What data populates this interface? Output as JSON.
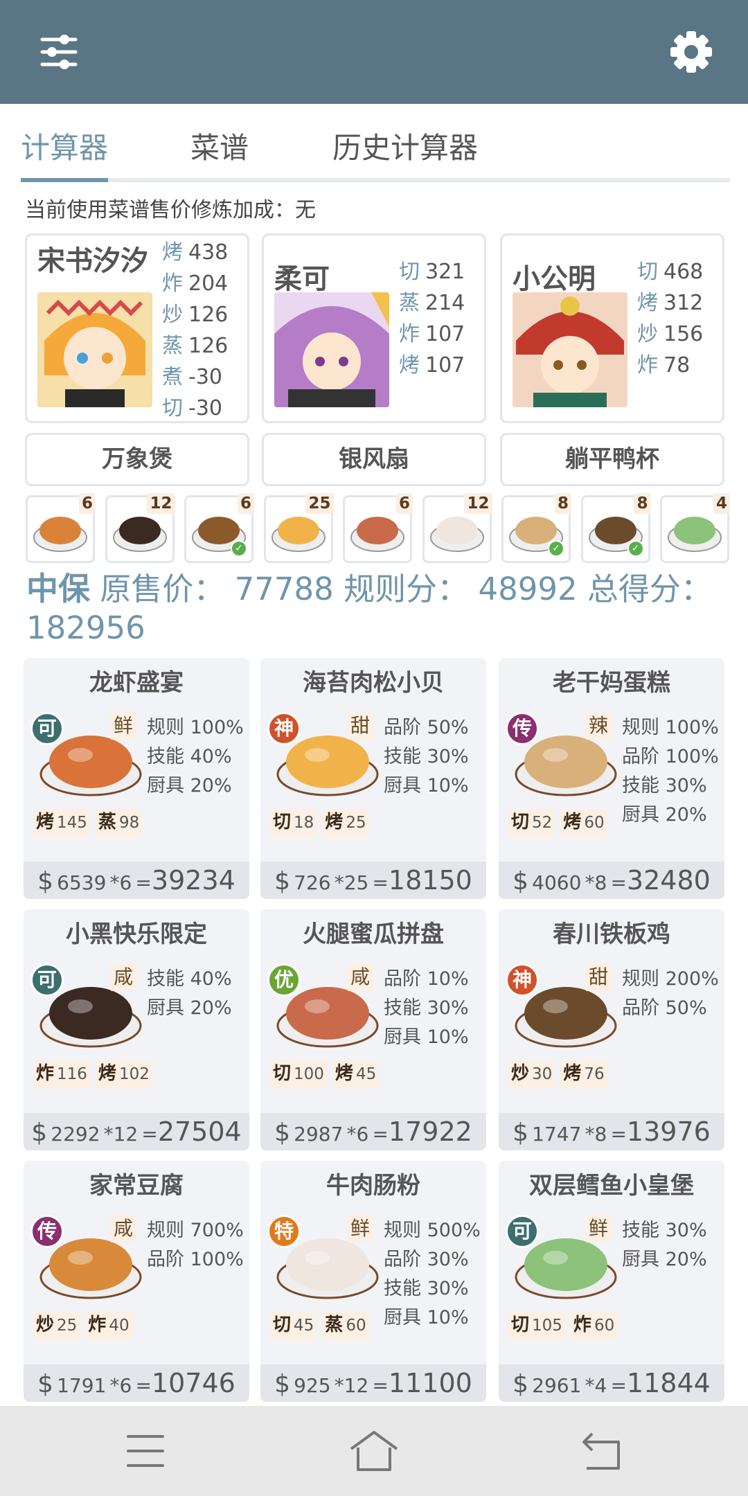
{
  "colors": {
    "header": "#5a7583",
    "accent": "#6f95ab"
  },
  "header": {
    "left_icon": "sliders-icon",
    "right_icon": "gear-icon"
  },
  "tabs": [
    {
      "label": "计算器",
      "active": true
    },
    {
      "label": "菜谱",
      "active": false
    },
    {
      "label": "历史计算器",
      "active": false
    }
  ],
  "bonus_text": "当前使用菜谱售价修炼加成：无",
  "chefs": [
    {
      "name": "宋书汐汐",
      "skills": [
        {
          "k": "烤",
          "v": "438"
        },
        {
          "k": "炸",
          "v": "204"
        },
        {
          "k": "炒",
          "v": "126"
        },
        {
          "k": "蒸",
          "v": "126"
        },
        {
          "k": "煮",
          "v": "-30"
        },
        {
          "k": "切",
          "v": "-30"
        }
      ]
    },
    {
      "name": "柔可",
      "skills": [
        {
          "k": "切",
          "v": "321"
        },
        {
          "k": "蒸",
          "v": "214"
        },
        {
          "k": "炸",
          "v": "107"
        },
        {
          "k": "烤",
          "v": "107"
        }
      ]
    },
    {
      "name": "小公明",
      "skills": [
        {
          "k": "切",
          "v": "468"
        },
        {
          "k": "烤",
          "v": "312"
        },
        {
          "k": "炒",
          "v": "156"
        },
        {
          "k": "炸",
          "v": "78"
        }
      ]
    }
  ],
  "equipment": [
    "万象煲",
    "银风扇",
    "躺平鸭杯"
  ],
  "thumbs": [
    {
      "count": "6",
      "checked": false
    },
    {
      "count": "12",
      "checked": false
    },
    {
      "count": "6",
      "checked": true
    },
    {
      "count": "25",
      "checked": false
    },
    {
      "count": "6",
      "checked": false
    },
    {
      "count": "12",
      "checked": false
    },
    {
      "count": "8",
      "checked": true
    },
    {
      "count": "8",
      "checked": true
    },
    {
      "count": "4",
      "checked": false
    }
  ],
  "totals": {
    "restaurant": "中保",
    "price_label": "原售价：",
    "price": "77788",
    "rule_label": "规则分：",
    "rule": "48992",
    "total_label": "总得分：",
    "total": "182956"
  },
  "dishes": [
    {
      "name": "龙虾盛宴",
      "rarity": "可",
      "flavor": "鲜",
      "stats": [
        "规则 100%",
        "技能 40%",
        "厨具 20%"
      ],
      "reqs": [
        {
          "k": "烤",
          "v": "145"
        },
        {
          "k": "蒸",
          "v": "98"
        }
      ],
      "price": "6539",
      "mult": "*6",
      "total": "39234"
    },
    {
      "name": "海苔肉松小贝",
      "rarity": "神",
      "flavor": "甜",
      "stats": [
        "品阶 50%",
        "技能 30%",
        "厨具 10%"
      ],
      "reqs": [
        {
          "k": "切",
          "v": "18"
        },
        {
          "k": "烤",
          "v": "25"
        }
      ],
      "price": "726",
      "mult": "*25",
      "total": "18150"
    },
    {
      "name": "老干妈蛋糕",
      "rarity": "传",
      "flavor": "辣",
      "stats": [
        "规则 100%",
        "品阶 100%",
        "技能 30%",
        "厨具 20%"
      ],
      "reqs": [
        {
          "k": "切",
          "v": "52"
        },
        {
          "k": "烤",
          "v": "60"
        }
      ],
      "price": "4060",
      "mult": "*8",
      "total": "32480"
    },
    {
      "name": "小黑快乐限定",
      "rarity": "可",
      "flavor": "咸",
      "stats": [
        "技能 40%",
        "厨具 20%"
      ],
      "reqs": [
        {
          "k": "炸",
          "v": "116"
        },
        {
          "k": "烤",
          "v": "102"
        }
      ],
      "price": "2292",
      "mult": "*12",
      "total": "27504"
    },
    {
      "name": "火腿蜜瓜拼盘",
      "rarity": "优",
      "flavor": "咸",
      "stats": [
        "品阶 10%",
        "技能 30%",
        "厨具 10%"
      ],
      "reqs": [
        {
          "k": "切",
          "v": "100"
        },
        {
          "k": "烤",
          "v": "45"
        }
      ],
      "price": "2987",
      "mult": "*6",
      "total": "17922"
    },
    {
      "name": "春川铁板鸡",
      "rarity": "神",
      "flavor": "甜",
      "stats": [
        "规则 200%",
        "品阶 50%"
      ],
      "reqs": [
        {
          "k": "炒",
          "v": "30"
        },
        {
          "k": "烤",
          "v": "76"
        }
      ],
      "price": "1747",
      "mult": "*8",
      "total": "13976"
    },
    {
      "name": "家常豆腐",
      "rarity": "传",
      "flavor": "咸",
      "stats": [
        "规则 700%",
        "品阶 100%"
      ],
      "reqs": [
        {
          "k": "炒",
          "v": "25"
        },
        {
          "k": "炸",
          "v": "40"
        }
      ],
      "price": "1791",
      "mult": "*6",
      "total": "10746"
    },
    {
      "name": "牛肉肠粉",
      "rarity": "特",
      "flavor": "鲜",
      "stats": [
        "规则 500%",
        "品阶 30%",
        "技能 30%",
        "厨具 10%"
      ],
      "reqs": [
        {
          "k": "切",
          "v": "45"
        },
        {
          "k": "蒸",
          "v": "60"
        }
      ],
      "price": "925",
      "mult": "*12",
      "total": "11100"
    },
    {
      "name": "双层鳕鱼小皇堡",
      "rarity": "可",
      "flavor": "鲜",
      "stats": [
        "技能 30%",
        "厨具 20%"
      ],
      "reqs": [
        {
          "k": "切",
          "v": "105"
        },
        {
          "k": "炸",
          "v": "60"
        }
      ],
      "price": "2961",
      "mult": "*4",
      "total": "11844"
    }
  ],
  "rarity_colors": {
    "可": "#3d6f6f",
    "神": "#d0512b",
    "传": "#8a2f6f",
    "优": "#6aa534",
    "特": "#e07b1c"
  },
  "navbar": [
    "menu-icon",
    "home-icon",
    "back-icon"
  ]
}
